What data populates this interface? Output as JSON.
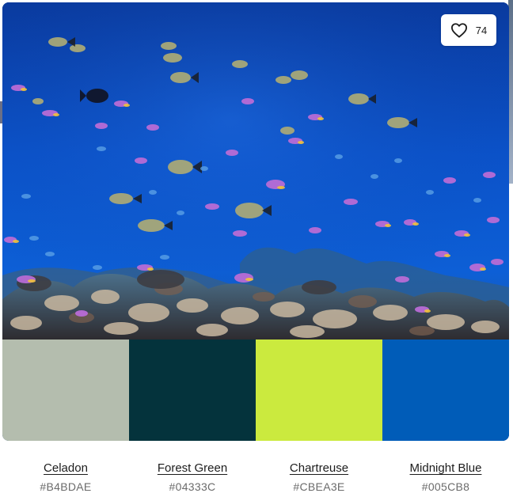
{
  "likes": {
    "icon": "heart-outline-icon",
    "count": "74"
  },
  "photo": {
    "subject": "underwater coral reef with schools of fish"
  },
  "palette": [
    {
      "name": "Celadon",
      "hex": "#B4BDAE",
      "color": "#B4BDAE"
    },
    {
      "name": "Forest Green",
      "hex": "#04333C",
      "color": "#04333C"
    },
    {
      "name": "Chartreuse",
      "hex": "#CBEA3E",
      "color": "#CBEA3E"
    },
    {
      "name": "Midnight Blue",
      "hex": "#005CB8",
      "color": "#005CB8"
    }
  ]
}
